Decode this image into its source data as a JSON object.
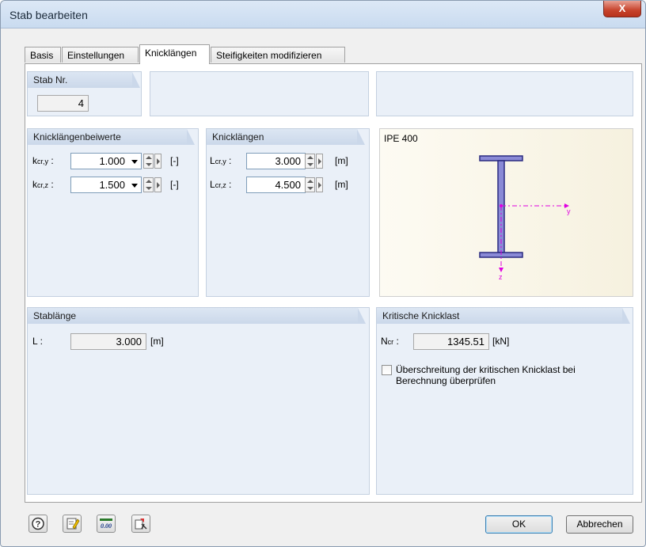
{
  "window": {
    "title": "Stab bearbeiten",
    "close_label": "X"
  },
  "tabs": [
    "Basis",
    "Einstellungen",
    "Knicklängen",
    "Steifigkeiten modifizieren"
  ],
  "active_tab": "Knicklängen",
  "stab_nr": {
    "header": "Stab Nr.",
    "value": "4"
  },
  "beiwerte": {
    "header": "Knicklängenbeiwerte",
    "rows": [
      {
        "label_main": "k",
        "label_sub": "cr,y",
        "value": "1.000",
        "unit": "[-]"
      },
      {
        "label_main": "k",
        "label_sub": "cr,z",
        "value": "1.500",
        "unit": "[-]"
      }
    ]
  },
  "knicklaengen": {
    "header": "Knicklängen",
    "rows": [
      {
        "label_main": "L",
        "label_sub": "cr,y",
        "value": "3.000",
        "unit": "[m]"
      },
      {
        "label_main": "L",
        "label_sub": "cr,z",
        "value": "4.500",
        "unit": "[m]"
      }
    ]
  },
  "preview": {
    "section": "IPE 400",
    "axis_y": "y",
    "axis_z": "z"
  },
  "stablaenge": {
    "header": "Stablänge",
    "label": "L :",
    "value": "3.000",
    "unit": "[m]"
  },
  "kritisch": {
    "header": "Kritische Knicklast",
    "label_main": "N",
    "label_sub": "cr",
    "value": "1345.51",
    "unit": "[kN]",
    "check_label_line1": "Überschreitung der kritischen Knicklast bei",
    "check_label_line2": "Berechnung überprüfen",
    "checked": false
  },
  "buttons": {
    "ok": "OK",
    "cancel": "Abbrechen"
  },
  "bottom_icons": [
    "help-icon",
    "edit-icon",
    "units-icon",
    "settings-icon"
  ],
  "bottom_icon_units_text": "0.00",
  "colors": {
    "accent": "#3c7fb1",
    "section_axis": "#e000e0",
    "profile": "#3a3a9a"
  }
}
